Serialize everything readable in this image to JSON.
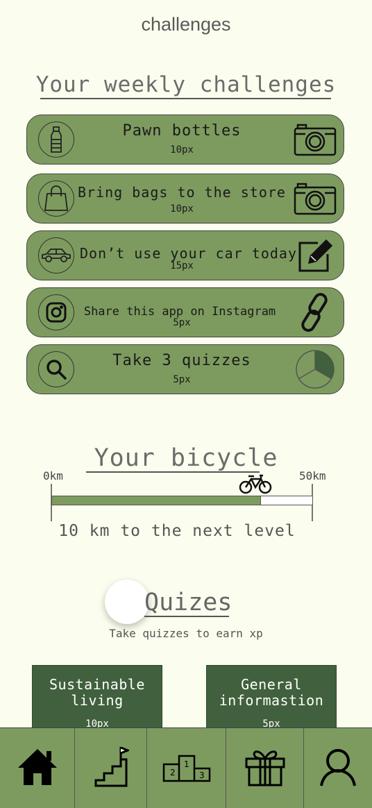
{
  "header": {
    "title": "challenges"
  },
  "weekly": {
    "title": "Your weekly challenges",
    "challenges": [
      {
        "icon": "bottle-icon",
        "title": "Pawn bottles",
        "points": "10px",
        "action_icon": "camera-icon"
      },
      {
        "icon": "shopping-bag-icon",
        "title": "Bring bags to the store",
        "points": "10px",
        "action_icon": "camera-icon"
      },
      {
        "icon": "car-icon",
        "title": "Don’t use your car today",
        "points": "15px",
        "action_icon": "edit-icon"
      },
      {
        "icon": "instagram-icon",
        "title": "Share this app on Instagram",
        "points": "5px",
        "action_icon": "link-icon"
      },
      {
        "icon": "search-icon",
        "title": "Take 3 quizzes",
        "points": "5px",
        "action_icon": "progress-pie-icon",
        "progress": 0.33
      }
    ]
  },
  "bicycle": {
    "title": "Your bicycle",
    "min_label": "0km",
    "max_label": "50km",
    "progress": 0.8,
    "note": "10 km to the next level"
  },
  "quizzes": {
    "title": "Quizes",
    "subtitle": "Take quizzes to earn xp",
    "cards": [
      {
        "title": "Sustainable living",
        "points": "10px"
      },
      {
        "title": "General informastion",
        "points": "5px"
      }
    ]
  },
  "nav": {
    "items": [
      {
        "icon": "home-icon"
      },
      {
        "icon": "stairs-flag-icon"
      },
      {
        "icon": "podium-icon"
      },
      {
        "icon": "gift-icon"
      },
      {
        "icon": "profile-icon"
      }
    ]
  },
  "colors": {
    "background": "#fbfdee",
    "card_green": "#7d9b5f",
    "dark_green": "#41603d"
  }
}
